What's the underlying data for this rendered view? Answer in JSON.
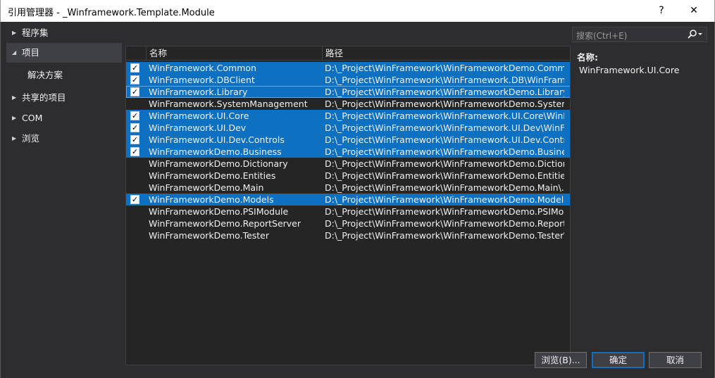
{
  "window": {
    "title": "引用管理器 - _Winframework.Template.Module",
    "help_label": "?",
    "close_label": "✕"
  },
  "nav": {
    "items": [
      {
        "label": "程序集",
        "arrow": "▶"
      },
      {
        "label": "项目",
        "arrow": "◢"
      },
      {
        "label": "解决方案",
        "arrow": ""
      },
      {
        "label": "共享的项目",
        "arrow": "▶"
      },
      {
        "label": "COM",
        "arrow": "▶"
      },
      {
        "label": "浏览",
        "arrow": "▶"
      }
    ]
  },
  "search": {
    "placeholder": "搜索(Ctrl+E)",
    "icon": "search-icon"
  },
  "list": {
    "columns": [
      "名称",
      "路径"
    ],
    "rows": [
      {
        "name": "WinFramework.Common",
        "path": "D:\\_Project\\WinFramework\\WinFrameworkDemo.Comm...",
        "checked": true
      },
      {
        "name": "WinFramework.DBClient",
        "path": "D:\\_Project\\WinFramework\\WinFramework.DB\\WinFram...",
        "checked": true
      },
      {
        "name": "WinFramework.Library",
        "path": "D:\\_Project\\WinFramework\\WinFrameworkDemo.Library...",
        "checked": true
      },
      {
        "name": "WinFramework.SystemManagement",
        "path": "D:\\_Project\\WinFramework\\WinFrameworkDemo.System...",
        "checked": false
      },
      {
        "name": "WinFramework.UI.Core",
        "path": "D:\\_Project\\WinFramework\\WinFramework.UI.Core\\WinF...",
        "checked": true
      },
      {
        "name": "WinFramework.UI.Dev",
        "path": "D:\\_Project\\WinFramework\\WinFramework.UI.Dev\\WinFr...",
        "checked": true
      },
      {
        "name": "WinFramework.UI.Dev.Controls",
        "path": "D:\\_Project\\WinFramework\\WinFramework.UI.Dev.Contr...",
        "checked": true
      },
      {
        "name": "WinFrameworkDemo.Business",
        "path": "D:\\_Project\\WinFramework\\WinFrameworkDemo.Busines...",
        "checked": true
      },
      {
        "name": "WinFrameworkDemo.Dictionary",
        "path": "D:\\_Project\\WinFramework\\WinFrameworkDemo.Diction...",
        "checked": false
      },
      {
        "name": "WinFrameworkDemo.Entities",
        "path": "D:\\_Project\\WinFramework\\WinFrameworkDemo.Entities...",
        "checked": false
      },
      {
        "name": "WinFrameworkDemo.Main",
        "path": "D:\\_Project\\WinFramework\\WinFrameworkDemo.Main\\...",
        "checked": false
      },
      {
        "name": "WinFrameworkDemo.Models",
        "path": "D:\\_Project\\WinFramework\\WinFrameworkDemo.Models...",
        "checked": true
      },
      {
        "name": "WinFrameworkDemo.PSIModule",
        "path": "D:\\_Project\\WinFramework\\WinFrameworkDemo.PSIMo...",
        "checked": false
      },
      {
        "name": "WinFrameworkDemo.ReportServer",
        "path": "D:\\_Project\\WinFramework\\WinFrameworkDemo.Report...",
        "checked": false
      },
      {
        "name": "WinFrameworkDemo.Tester",
        "path": "D:\\_Project\\WinFramework\\WinFrameworkDemo.Tester\\...",
        "checked": false
      }
    ]
  },
  "detail": {
    "label": "名称:",
    "value": "WinFramework.UI.Core"
  },
  "buttons": {
    "browse": "浏览(B)...",
    "ok": "确定",
    "cancel": "取消"
  },
  "colors": {
    "background": "#2d2d30",
    "selection": "#0e70c0",
    "text": "#f1f1f1"
  }
}
